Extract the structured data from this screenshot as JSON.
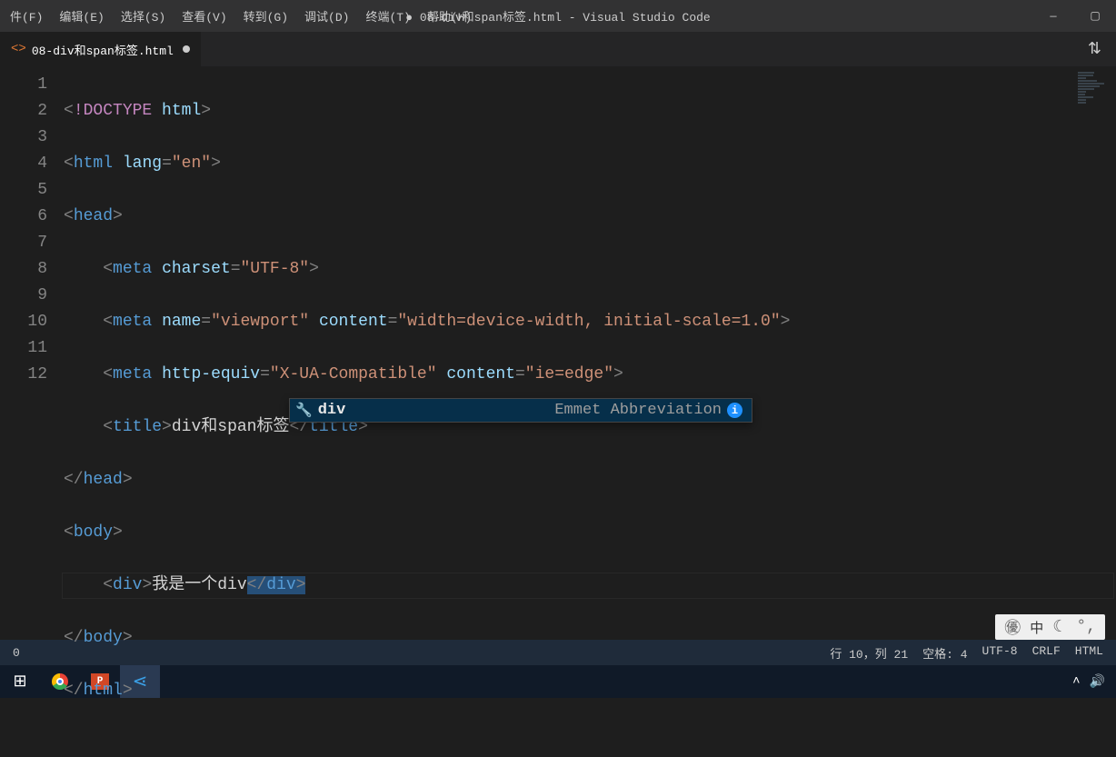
{
  "titlebar": {
    "title": "● 08-div和span标签.html - Visual Studio Code"
  },
  "menu": {
    "items": [
      "件(F)",
      "编辑(E)",
      "选择(S)",
      "查看(V)",
      "转到(G)",
      "调试(D)",
      "终端(T)",
      "帮助(H)"
    ]
  },
  "tab": {
    "label": "08-div和span标签.html"
  },
  "code": {
    "line1_doctype": "!DOCTYPE",
    "line1_html": "html",
    "line2_tag": "html",
    "line2_attr": "lang",
    "line2_val": "\"en\"",
    "line3_tag": "head",
    "line4_tag": "meta",
    "line4_attr": "charset",
    "line4_val": "\"UTF-8\"",
    "line5_tag": "meta",
    "line5_attr1": "name",
    "line5_val1": "\"viewport\"",
    "line5_attr2": "content",
    "line5_val2": "\"width=device-width, initial-scale=1.0\"",
    "line6_tag": "meta",
    "line6_attr1": "http-equiv",
    "line6_val1": "\"X-UA-Compatible\"",
    "line6_attr2": "content",
    "line6_val2": "\"ie=edge\"",
    "line7_tag": "title",
    "line7_text": "div和span标签",
    "line8_tag": "head",
    "line9_tag": "body",
    "line10_tag": "div",
    "line10_text": "我是一个div",
    "line11_tag": "body",
    "line12_tag": "html"
  },
  "suggest": {
    "label": "div",
    "hint": "Emmet Abbreviation"
  },
  "status": {
    "left": "0",
    "cursor": "行 10，列 21",
    "spaces": "空格: 4",
    "encoding": "UTF-8",
    "eol": "CRLF",
    "lang": "HTML"
  },
  "ime": {
    "lang": "中"
  }
}
